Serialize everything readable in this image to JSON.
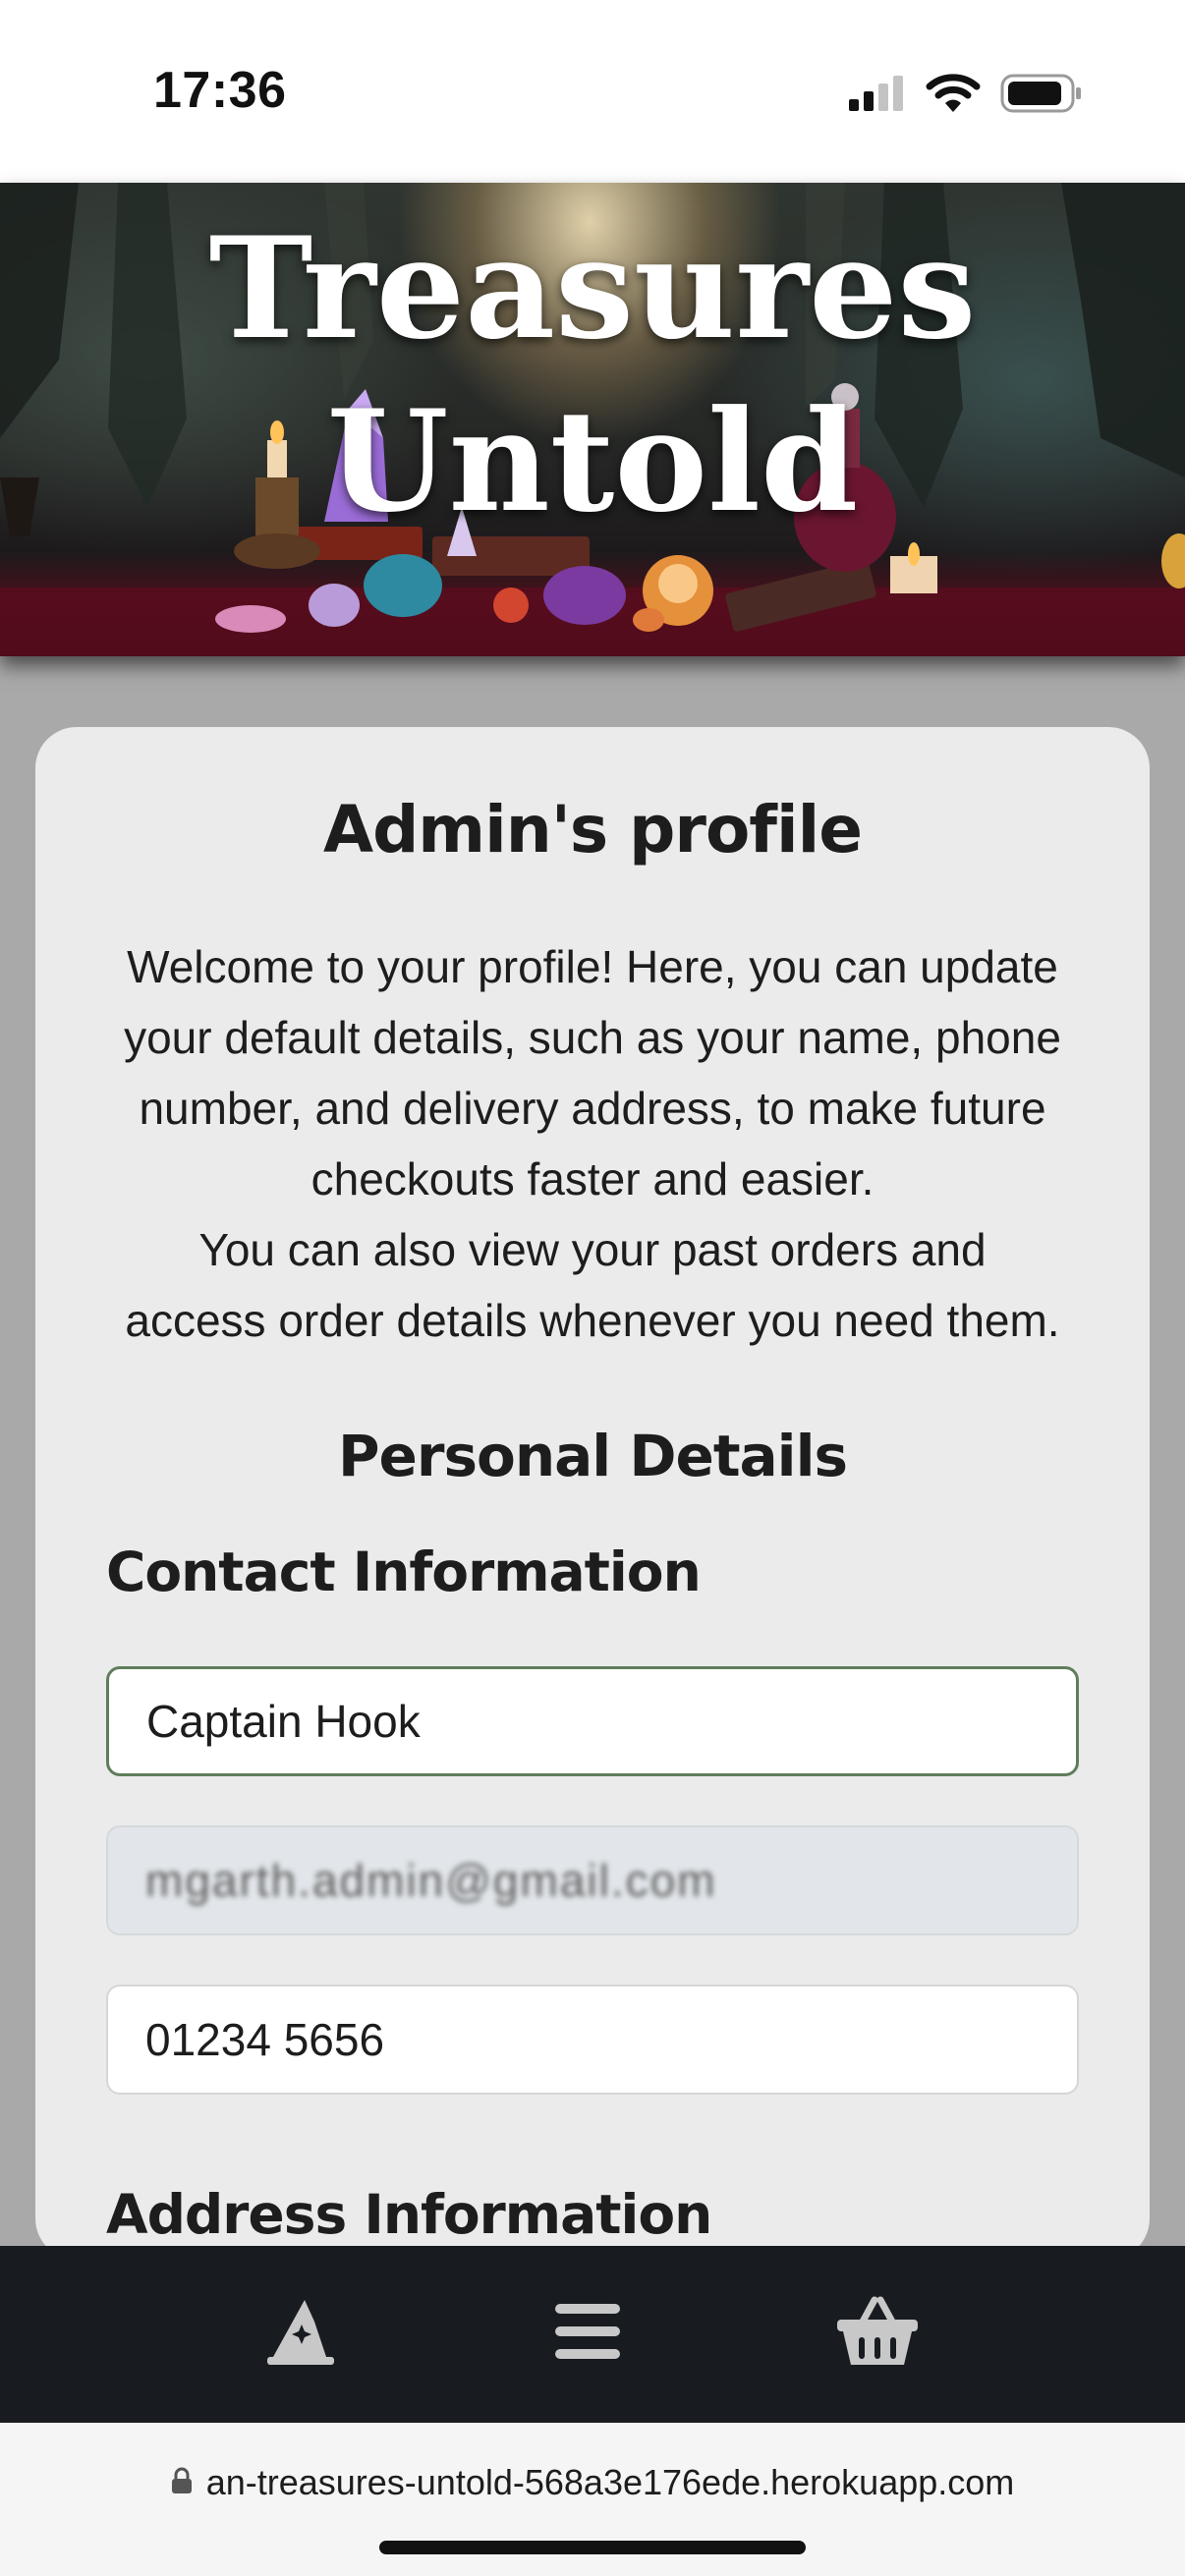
{
  "status_bar": {
    "time": "17:36",
    "icons": [
      "cellular-signal-icon",
      "wifi-icon",
      "battery-icon"
    ]
  },
  "hero": {
    "title_line1": "Treasures",
    "title_line2": "Untold"
  },
  "profile": {
    "title": "Admin's profile",
    "intro_line1": "Welcome to your profile! Here, you can update",
    "intro_line2": "your default details, such as your name, phone",
    "intro_line3": "number, and delivery address, to make future",
    "intro_line4": "checkouts faster and easier.",
    "intro_line5": "You can also view your past orders and",
    "intro_line6": "access order details whenever you need them."
  },
  "personal_details": {
    "title": "Personal Details",
    "contact_title": "Contact Information",
    "name_value": "Captain Hook",
    "email_value": "mgarth.admin@gmail.com",
    "phone_value": "01234 5656",
    "address_title": "Address Information"
  },
  "bottom_nav": {
    "items": [
      "wizard-hat-icon",
      "menu-icon",
      "basket-icon"
    ]
  },
  "url_bar": {
    "url": "an-treasures-untold-568a3e176ede.herokuapp.com"
  },
  "colors": {
    "page_bg": "#a9a9a9",
    "card_bg": "#ebebeb",
    "nav_bg": "#181b20",
    "focus_border": "#5f7d5c"
  }
}
